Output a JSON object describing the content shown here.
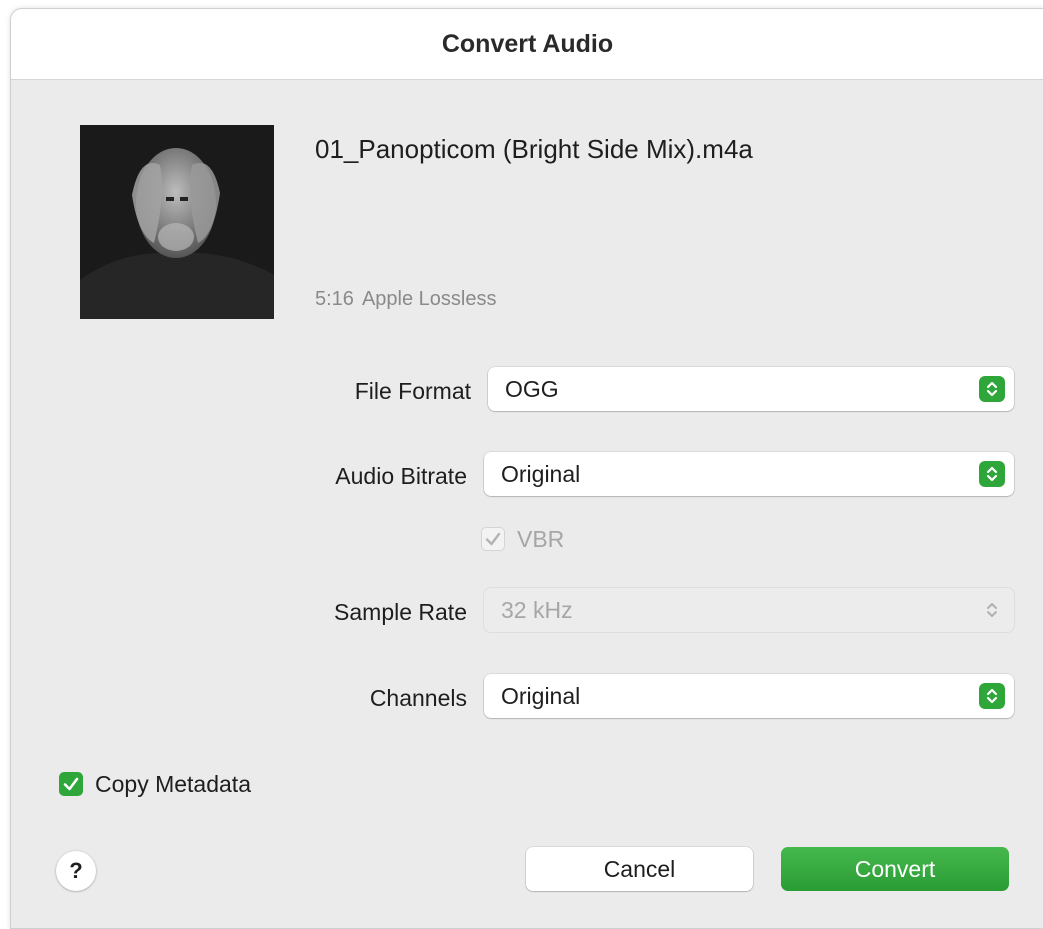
{
  "dialog": {
    "title": "Convert Audio"
  },
  "track": {
    "filename": "01_Panopticom (Bright Side Mix).m4a",
    "duration": "5:16",
    "codec": "Apple Lossless"
  },
  "settings": {
    "file_format": {
      "label": "File Format",
      "value": "OGG"
    },
    "audio_bitrate": {
      "label": "Audio Bitrate",
      "value": "Original"
    },
    "vbr": {
      "label": "VBR",
      "checked": true,
      "enabled": false
    },
    "sample_rate": {
      "label": "Sample Rate",
      "value": "32 kHz",
      "enabled": false
    },
    "channels": {
      "label": "Channels",
      "value": "Original"
    }
  },
  "copy_metadata": {
    "label": "Copy Metadata",
    "checked": true
  },
  "buttons": {
    "help": "?",
    "cancel": "Cancel",
    "convert": "Convert"
  },
  "colors": {
    "accent": "#2fa63a",
    "background": "#ebebeb"
  },
  "icons": {
    "stepper": "chevron-updown-icon",
    "check": "checkmark-icon"
  }
}
